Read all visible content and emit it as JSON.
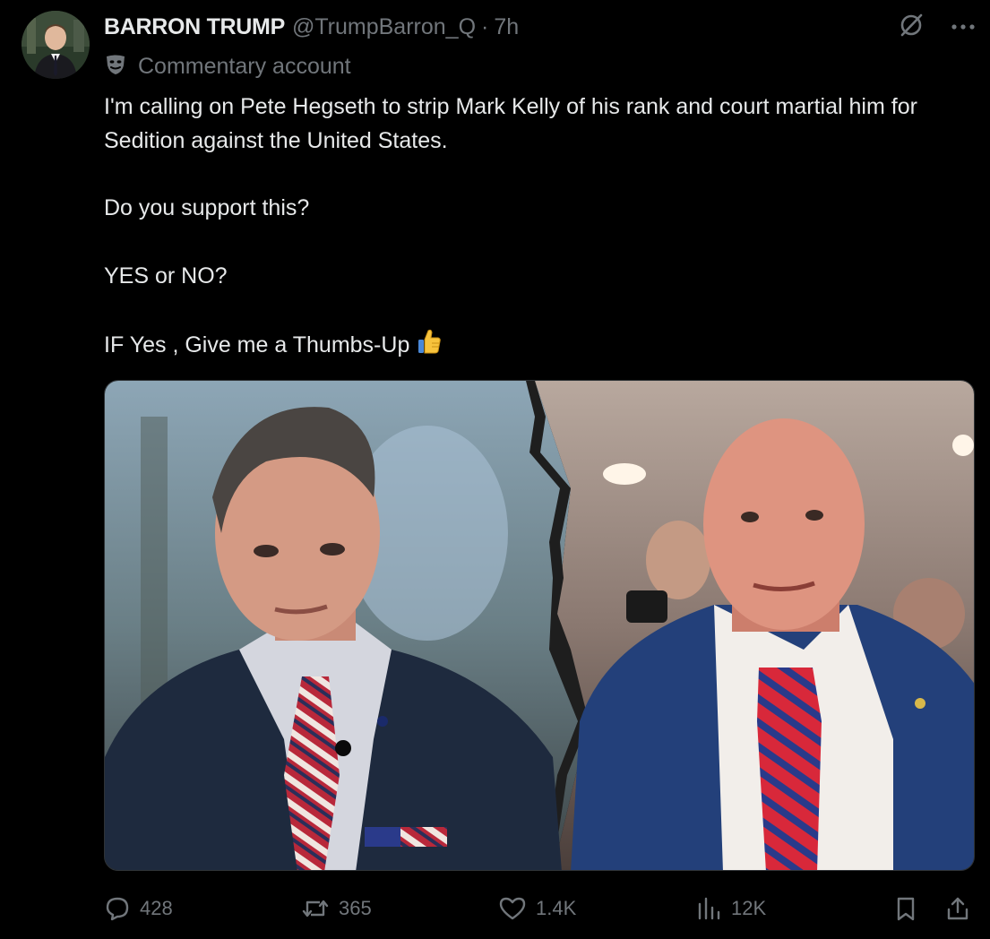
{
  "author": {
    "display_name": "BARRON TRUMP",
    "handle": "@TrumpBarron_Q",
    "separator": "·",
    "time": "7h",
    "avatar_icon": "profile-photo"
  },
  "label": {
    "icon": "theater-mask-icon",
    "text": "Commentary account"
  },
  "post": {
    "paragraph1": "I'm calling on Pete Hegseth to strip Mark Kelly of his rank and court martial him for Sedition against the United States.",
    "paragraph2": "Do you support this?",
    "paragraph3": "YES or NO?",
    "paragraph4": "IF Yes , Give me a Thumbs-Up",
    "emoji": "thumbs-up-emoji"
  },
  "media": {
    "description_icon": "split-photo"
  },
  "actions": {
    "replies": "428",
    "reposts": "365",
    "likes": "1.4K",
    "views": "12K"
  },
  "colors": {
    "background": "#000000",
    "primary_text": "#e7e9ea",
    "secondary_text": "#71767b",
    "border": "#2f3336"
  }
}
